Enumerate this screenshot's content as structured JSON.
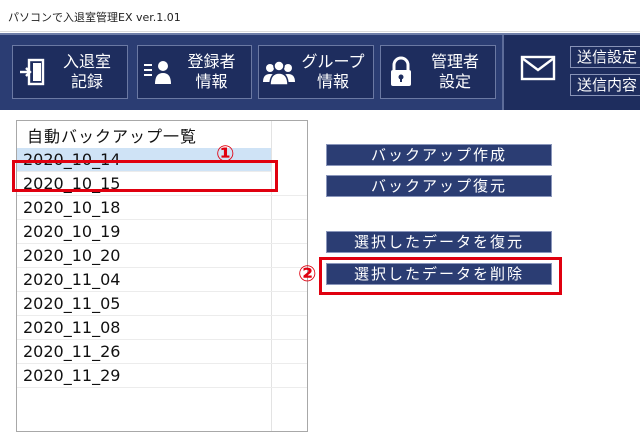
{
  "window": {
    "title": "パソコンで入退室管理EX ver.1.01"
  },
  "toolbar": {
    "buttons": [
      {
        "label": "入退室\n記録",
        "icon": "door-exit-icon"
      },
      {
        "label": "登録者\n情報",
        "icon": "user-list-icon"
      },
      {
        "label": "グループ\n情報",
        "icon": "group-icon"
      },
      {
        "label": "管理者\n設定",
        "icon": "lock-icon"
      }
    ],
    "mail_icon": "envelope-icon",
    "send_buttons": [
      {
        "label": "送信設定"
      },
      {
        "label": "送信内容"
      }
    ]
  },
  "backup_list": {
    "header": "自動バックアップ一覧",
    "selected_index": 0,
    "items": [
      "2020_10_14",
      "2020_10_15",
      "2020_10_18",
      "2020_10_19",
      "2020_10_20",
      "2020_11_04",
      "2020_11_05",
      "2020_11_08",
      "2020_11_26",
      "2020_11_29"
    ]
  },
  "actions": {
    "create_backup": "バックアップ作成",
    "restore_backup": "バックアップ復元",
    "restore_selected": "選択したデータを復元",
    "delete_selected": "選択したデータを削除"
  },
  "annotations": {
    "marker_1": "①",
    "marker_2": "②"
  },
  "colors": {
    "toolbar_bg": "#2b3d73",
    "button_bg": "#1e2d5e",
    "selection": "#cfe3f6",
    "highlight": "#e0000f"
  }
}
